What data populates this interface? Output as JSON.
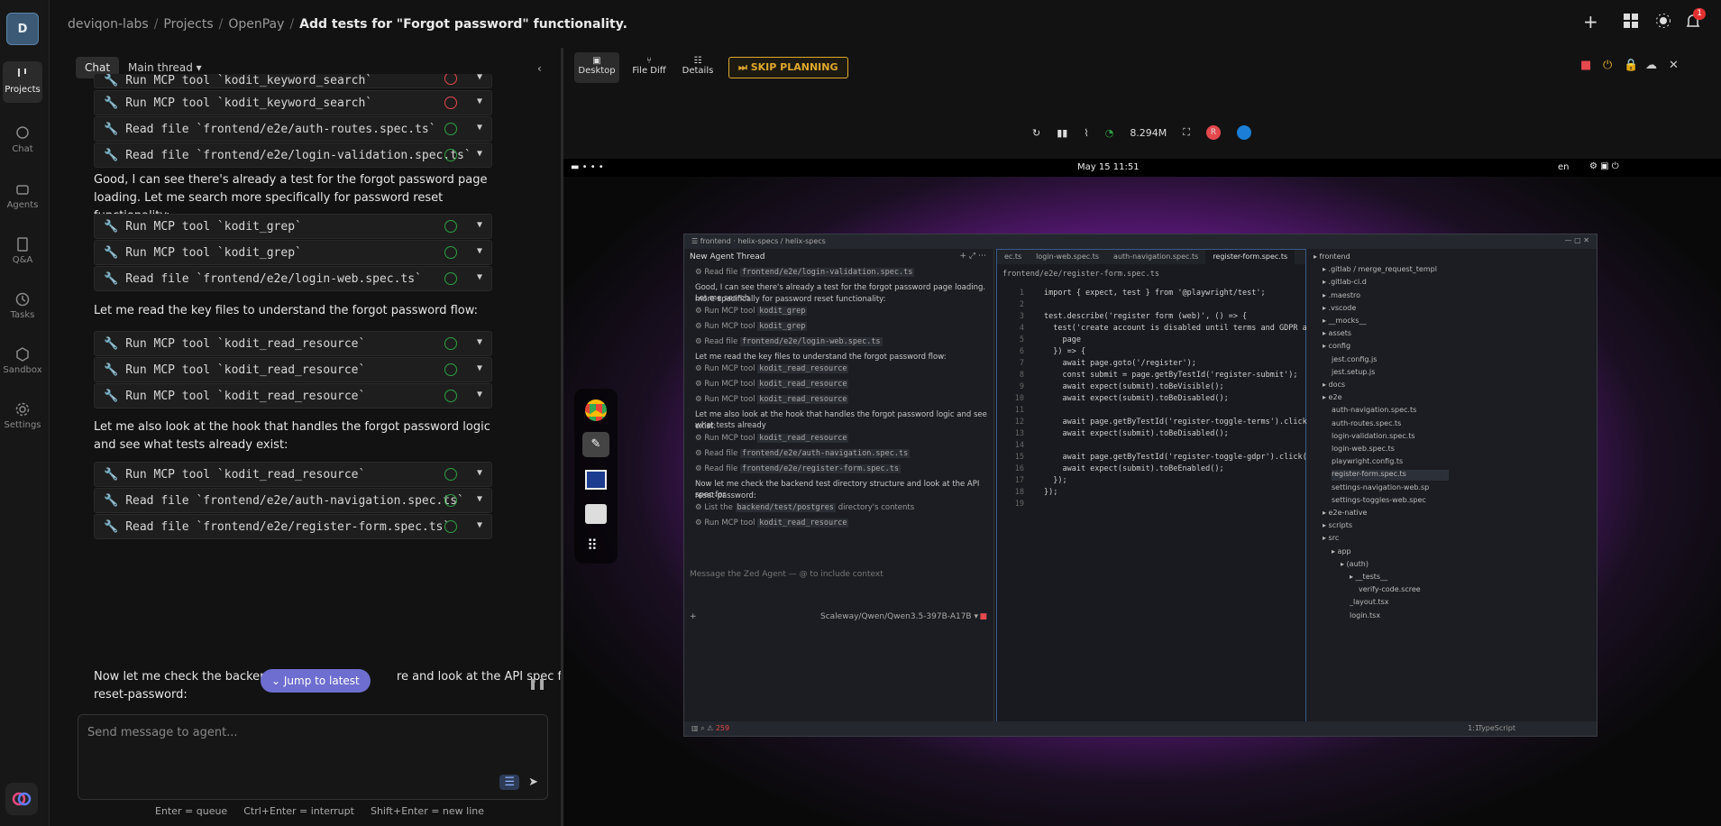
{
  "nav": {
    "logo": "D",
    "items": [
      {
        "label": "Projects",
        "icon": "projects-icon"
      },
      {
        "label": "Chat",
        "icon": "chat-icon"
      },
      {
        "label": "Agents",
        "icon": "agents-icon"
      },
      {
        "label": "Q&A",
        "icon": "qa-icon"
      },
      {
        "label": "Tasks",
        "icon": "tasks-icon"
      },
      {
        "label": "Sandbox",
        "icon": "sandbox-icon"
      },
      {
        "label": "Settings",
        "icon": "settings-icon"
      }
    ]
  },
  "breadcrumb": {
    "org": "deviqon-labs",
    "projects": "Projects",
    "project": "OpenPay",
    "task": "Add tests for \"Forgot password\" functionality."
  },
  "notifications": "1",
  "chat": {
    "tab": "Chat",
    "thread": "Main thread",
    "tools": [
      "Run MCP tool `kodit_keyword_search`",
      "Read file `frontend/e2e/auth-routes.spec.ts`",
      "Read file `frontend/e2e/login-validation.spec.ts`",
      "Run MCP tool `kodit_grep`",
      "Run MCP tool `kodit_grep`",
      "Read file `frontend/e2e/login-web.spec.ts`",
      "Run MCP tool `kodit_read_resource`",
      "Run MCP tool `kodit_read_resource`",
      "Run MCP tool `kodit_read_resource`",
      "Run MCP tool `kodit_read_resource`",
      "Read file `frontend/e2e/auth-navigation.spec.ts`",
      "Read file `frontend/e2e/register-form.spec.ts`"
    ],
    "para1": "Good, I can see there's already a test for the forgot password page loading. Let me search more specifically for password reset functionality:",
    "para2": "Let me read the key files to understand the forgot password flow:",
    "para3": "Let me also look at the hook that handles the forgot password logic and see what tests already exist:",
    "para4a": "Now let me check the backend t",
    "para4b": "re and look at the API spec for",
    "para4c": "reset-password:",
    "jump": "Jump to latest",
    "placeholder": "Send message to agent...",
    "hint1": "Enter = queue",
    "hint2": "Ctrl+Enter = interrupt",
    "hint3": "Shift+Enter = new line"
  },
  "toolbar": {
    "desktop": "Desktop",
    "filediff": "File Diff",
    "details": "Details",
    "skip": "SKIP PLANNING"
  },
  "vnc": {
    "mem": "8.294M",
    "r": "R",
    "date": "May 15  11:51",
    "lang": "en"
  },
  "zed": {
    "project": "frontend",
    "branch1": "helix-specs",
    "branch2": "helix-specs",
    "thread": "New Agent Thread",
    "lines": [
      {
        "t": "Read file",
        "c": "frontend/e2e/login-validation.spec.ts"
      },
      {
        "p": "Good, I can see there's already a test for the forgot password page loading. Let me search"
      },
      {
        "p": "more specifically for password reset functionality:"
      },
      {
        "t": "Run MCP tool",
        "c": "kodit_grep"
      },
      {
        "t": "Run MCP tool",
        "c": "kodit_grep"
      },
      {
        "t": "Read file",
        "c": "frontend/e2e/login-web.spec.ts"
      },
      {
        "p": "Let me read the key files to understand the forgot password flow:"
      },
      {
        "t": "Run MCP tool",
        "c": "kodit_read_resource"
      },
      {
        "t": "Run MCP tool",
        "c": "kodit_read_resource"
      },
      {
        "t": "Run MCP tool",
        "c": "kodit_read_resource"
      },
      {
        "p": "Let me also look at the hook that handles the forgot password logic and see what tests already"
      },
      {
        "p": "exist:"
      },
      {
        "t": "Run MCP tool",
        "c": "kodit_read_resource"
      },
      {
        "t": "Read file",
        "c": "frontend/e2e/auth-navigation.spec.ts"
      },
      {
        "t": "Read file",
        "c": "frontend/e2e/register-form.spec.ts"
      },
      {
        "p": "Now let me check the backend test directory structure and look at the API spec for"
      },
      {
        "p": "reset-password:"
      },
      {
        "t": "List the",
        "c": "backend/test/postgres",
        "s": "directory's contents"
      },
      {
        "t": "Run MCP tool",
        "c": "kodit_read_resource"
      }
    ],
    "input": "Message the Zed Agent — @ to include context",
    "model": "Scaleway/Qwen/Qwen3.5-397B-A17B",
    "errors": "259",
    "tabs": [
      "ec.ts",
      "login-web.spec.ts",
      "auth-navigation.spec.ts",
      "register-form.spec.ts"
    ],
    "path": "frontend/e2e/register-form.spec.ts",
    "code": [
      "import { expect, test } from '@playwright/test';",
      "",
      "test.describe('register form (web)', () => {",
      "  test('create account is disabled until terms and GDPR are",
      "    page",
      "  }) => {",
      "    await page.goto('/register');",
      "    const submit = page.getByTestId('register-submit');",
      "    await expect(submit).toBeVisible();",
      "    await expect(submit).toBeDisabled();",
      "",
      "    await page.getByTestId('register-toggle-terms').click();",
      "    await expect(submit).toBeDisabled();",
      "",
      "    await page.getByTestId('register-toggle-gdpr').click();",
      "    await expect(submit).toBeEnabled();",
      "  });",
      "});",
      ""
    ],
    "tree": [
      {
        "n": "frontend",
        "d": 0
      },
      {
        "n": ".gitlab / merge_request_templ",
        "d": 1
      },
      {
        "n": ".gitlab-ci.d",
        "d": 1
      },
      {
        "n": ".maestro",
        "d": 1
      },
      {
        "n": ".vscode",
        "d": 1
      },
      {
        "n": "__mocks__",
        "d": 1
      },
      {
        "n": "assets",
        "d": 1
      },
      {
        "n": "config",
        "d": 1
      },
      {
        "n": "jest.config.js",
        "d": 2
      },
      {
        "n": "jest.setup.js",
        "d": 2
      },
      {
        "n": "docs",
        "d": 1
      },
      {
        "n": "e2e",
        "d": 1
      },
      {
        "n": "auth-navigation.spec.ts",
        "d": 2
      },
      {
        "n": "auth-routes.spec.ts",
        "d": 2
      },
      {
        "n": "login-validation.spec.ts",
        "d": 2
      },
      {
        "n": "login-web.spec.ts",
        "d": 2
      },
      {
        "n": "playwright.config.ts",
        "d": 2
      },
      {
        "n": "register-form.spec.ts",
        "d": 2,
        "sel": true
      },
      {
        "n": "settings-navigation-web.sp",
        "d": 2
      },
      {
        "n": "settings-toggles-web.spec",
        "d": 2
      },
      {
        "n": "e2e-native",
        "d": 1
      },
      {
        "n": "scripts",
        "d": 1
      },
      {
        "n": "src",
        "d": 1
      },
      {
        "n": "app",
        "d": 2
      },
      {
        "n": "(auth)",
        "d": 3
      },
      {
        "n": "__tests__",
        "d": 4
      },
      {
        "n": "verify-code.scree",
        "d": 5
      },
      {
        "n": "_layout.tsx",
        "d": 4
      },
      {
        "n": "login.tsx",
        "d": 4
      }
    ],
    "cursor": "1:1",
    "lang": "TypeScript"
  }
}
